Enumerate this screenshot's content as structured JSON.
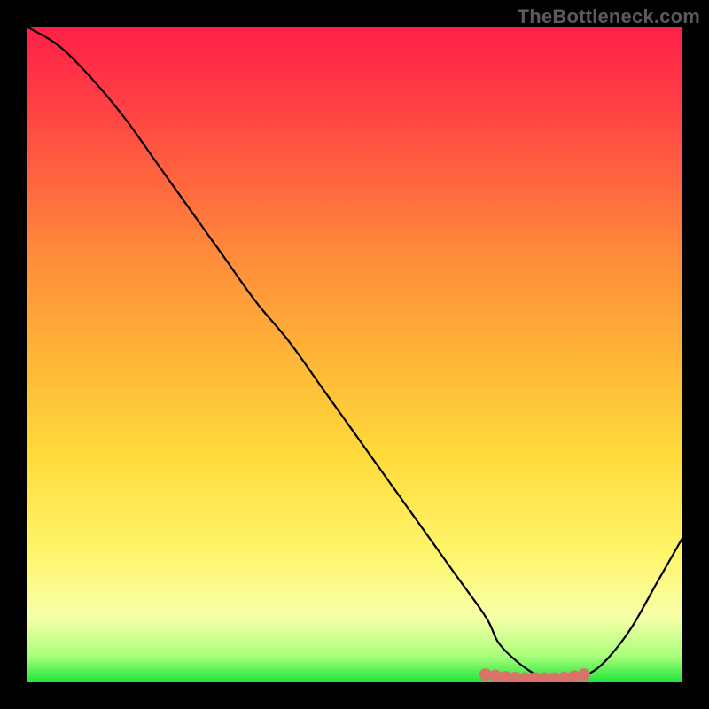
{
  "watermark": "TheBottleneck.com",
  "chart_data": {
    "type": "line",
    "title": "",
    "xlabel": "",
    "ylabel": "",
    "xlim": [
      0,
      100
    ],
    "ylim": [
      0,
      100
    ],
    "grid": false,
    "legend": false,
    "series": [
      {
        "name": "bottleneck-curve",
        "x": [
          0,
          5,
          10,
          15,
          20,
          25,
          30,
          35,
          40,
          45,
          50,
          55,
          60,
          65,
          70,
          72,
          75,
          78,
          80,
          82,
          85,
          88,
          92,
          96,
          100
        ],
        "y": [
          100,
          97,
          92,
          86,
          79,
          72,
          65,
          58,
          52,
          45,
          38,
          31,
          24,
          17,
          10,
          6,
          3,
          1,
          0.5,
          0.5,
          1,
          3,
          8,
          15,
          22
        ]
      }
    ],
    "markers": {
      "name": "highlight-dots",
      "x": [
        70,
        71.5,
        73,
        74.5,
        76,
        77.5,
        79,
        80.5,
        82,
        83.5,
        85
      ],
      "y": [
        1.2,
        1.0,
        0.8,
        0.7,
        0.6,
        0.6,
        0.6,
        0.6,
        0.7,
        0.9,
        1.2
      ],
      "color": "#d9726a",
      "radius": 7
    }
  },
  "colors": {
    "background": "#000000",
    "curve": "#000000",
    "marker": "#d9726a"
  }
}
